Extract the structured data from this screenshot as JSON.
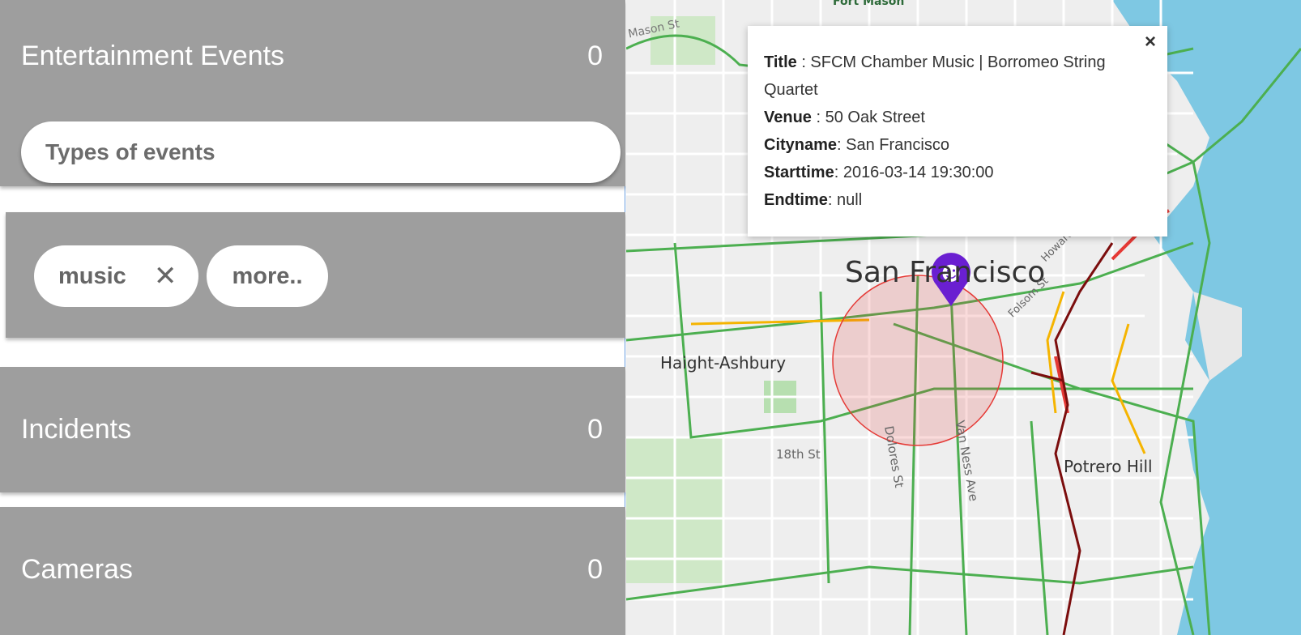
{
  "sidebar": {
    "entertainment": {
      "title": "Entertainment Events",
      "count": "0"
    },
    "search": {
      "placeholder": "Types of events"
    },
    "chips": [
      {
        "label": "music"
      },
      {
        "label": "more.."
      }
    ],
    "incidents": {
      "title": "Incidents",
      "count": "0"
    },
    "cameras": {
      "title": "Cameras",
      "count": "0"
    }
  },
  "map": {
    "labels": {
      "fort_mason": "Fort Mason",
      "city": "San Francisco",
      "haight": "Haight-Ashbury",
      "potrero": "Potrero Hill",
      "dolores": "Dolores St",
      "eighteenth": "18th St",
      "van_ness": "Van Ness Ave",
      "mason_st": "Mason St",
      "howard": "Howard St",
      "folsom": "Folsom St"
    },
    "colors": {
      "water": "#7ec8e3",
      "park": "#b7dfb0",
      "traffic_free": "#4caf50",
      "traffic_slow": "#f5b400",
      "traffic_jam": "#e53935",
      "traffic_stop": "#7b0d0d",
      "marker": "#6a1fd1"
    }
  },
  "popup": {
    "close": "×",
    "title_label": "Title",
    "title_value": " : SFCM Chamber Music | Borromeo String Quartet",
    "venue_label": "Venue",
    "venue_value": " : 50 Oak Street",
    "city_label": "Cityname",
    "city_value": ": San Francisco",
    "start_label": "Starttime",
    "start_value": ": 2016-03-14 19:30:00",
    "end_label": "Endtime",
    "end_value": ": null"
  }
}
